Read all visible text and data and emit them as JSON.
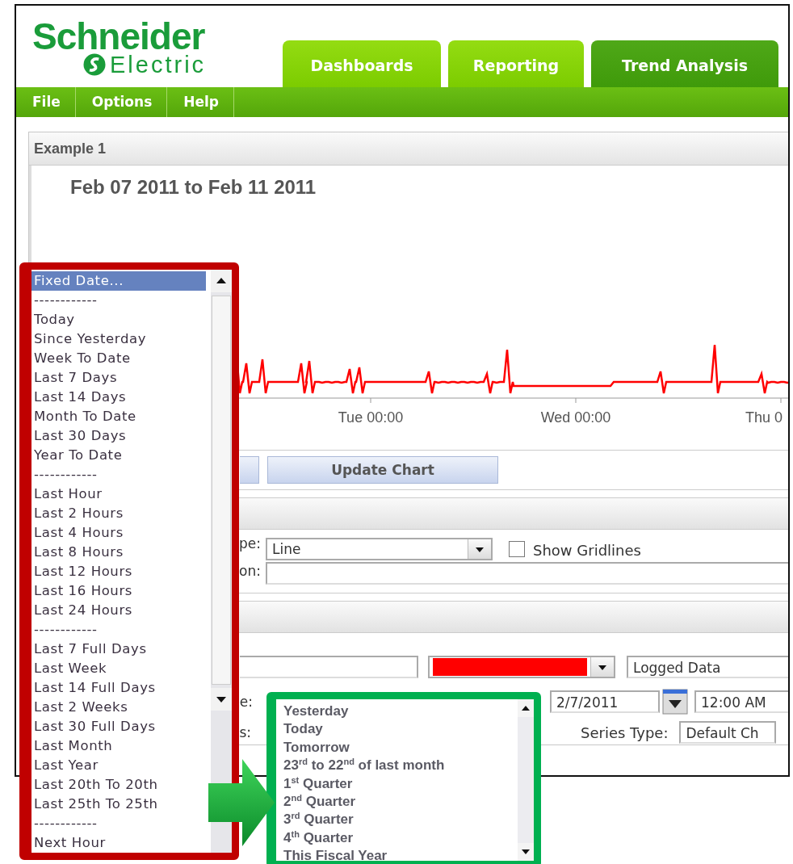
{
  "logo": {
    "name": "Schneider",
    "subname": "Electric"
  },
  "tabs": [
    {
      "label": "Dashboards",
      "selected": false
    },
    {
      "label": "Reporting",
      "selected": false
    },
    {
      "label": "Trend Analysis",
      "selected": true
    }
  ],
  "menu": [
    "File",
    "Options",
    "Help"
  ],
  "panel": {
    "title": "Example 1",
    "chart_title": "Feb 07 2011 to Feb 11 2011",
    "x_labels": [
      "Tue 00:00",
      "Wed 00:00",
      "Thu 0"
    ]
  },
  "update_button": "Update Chart",
  "chart_options": {
    "type_label": "pe:",
    "type_value": "Line",
    "gridlines_label": "Show Gridlines",
    "gridlines_checked": false,
    "description_label": "on:"
  },
  "series": {
    "color": "#ff0000",
    "source": "Logged Data",
    "start_label": "e:",
    "start_date": "2/7/2011",
    "start_time": "12:00 AM",
    "row_label": "s:",
    "series_type_label": "Series Type:",
    "series_type_value": "Default Ch"
  },
  "range_list": {
    "items": [
      {
        "label": "Fixed Date...",
        "selected": true
      },
      {
        "label": "------------",
        "selected": false
      },
      {
        "label": "Today",
        "selected": false
      },
      {
        "label": "Since Yesterday",
        "selected": false
      },
      {
        "label": "Week To Date",
        "selected": false
      },
      {
        "label": "Last 7 Days",
        "selected": false
      },
      {
        "label": "Last 14 Days",
        "selected": false
      },
      {
        "label": "Month To Date",
        "selected": false
      },
      {
        "label": "Last 30 Days",
        "selected": false
      },
      {
        "label": "Year To Date",
        "selected": false
      },
      {
        "label": "------------",
        "selected": false
      },
      {
        "label": "Last Hour",
        "selected": false
      },
      {
        "label": "Last 2 Hours",
        "selected": false
      },
      {
        "label": "Last 4 Hours",
        "selected": false
      },
      {
        "label": "Last 8 Hours",
        "selected": false
      },
      {
        "label": "Last 12 Hours",
        "selected": false
      },
      {
        "label": "Last 16 Hours",
        "selected": false
      },
      {
        "label": "Last 24 Hours",
        "selected": false
      },
      {
        "label": "------------",
        "selected": false
      },
      {
        "label": "Last 7 Full Days",
        "selected": false
      },
      {
        "label": "Last Week",
        "selected": false
      },
      {
        "label": "Last 14 Full Days",
        "selected": false
      },
      {
        "label": "Last 2 Weeks",
        "selected": false
      },
      {
        "label": "Last 30 Full Days",
        "selected": false
      },
      {
        "label": "Last Month",
        "selected": false
      },
      {
        "label": "Last Year",
        "selected": false
      },
      {
        "label": "Last 20th To 20th",
        "selected": false
      },
      {
        "label": "Last 25th To 25th",
        "selected": false
      },
      {
        "label": "------------",
        "selected": false
      },
      {
        "label": "Next Hour",
        "selected": false
      }
    ]
  },
  "range_popup": {
    "items": [
      {
        "label": "Yesterday"
      },
      {
        "label": "Today"
      },
      {
        "label": "Tomorrow"
      },
      {
        "label": "23$^{rd}$ to 22$^{nd}$ of last month"
      },
      {
        "label": "1$^{st}$ Quarter"
      },
      {
        "label": "2$^{nd}$ Quarter"
      },
      {
        "label": "3$^{rd}$ Quarter"
      },
      {
        "label": "4$^{th}$ Quarter"
      },
      {
        "label": "This Fiscal Year"
      }
    ]
  }
}
